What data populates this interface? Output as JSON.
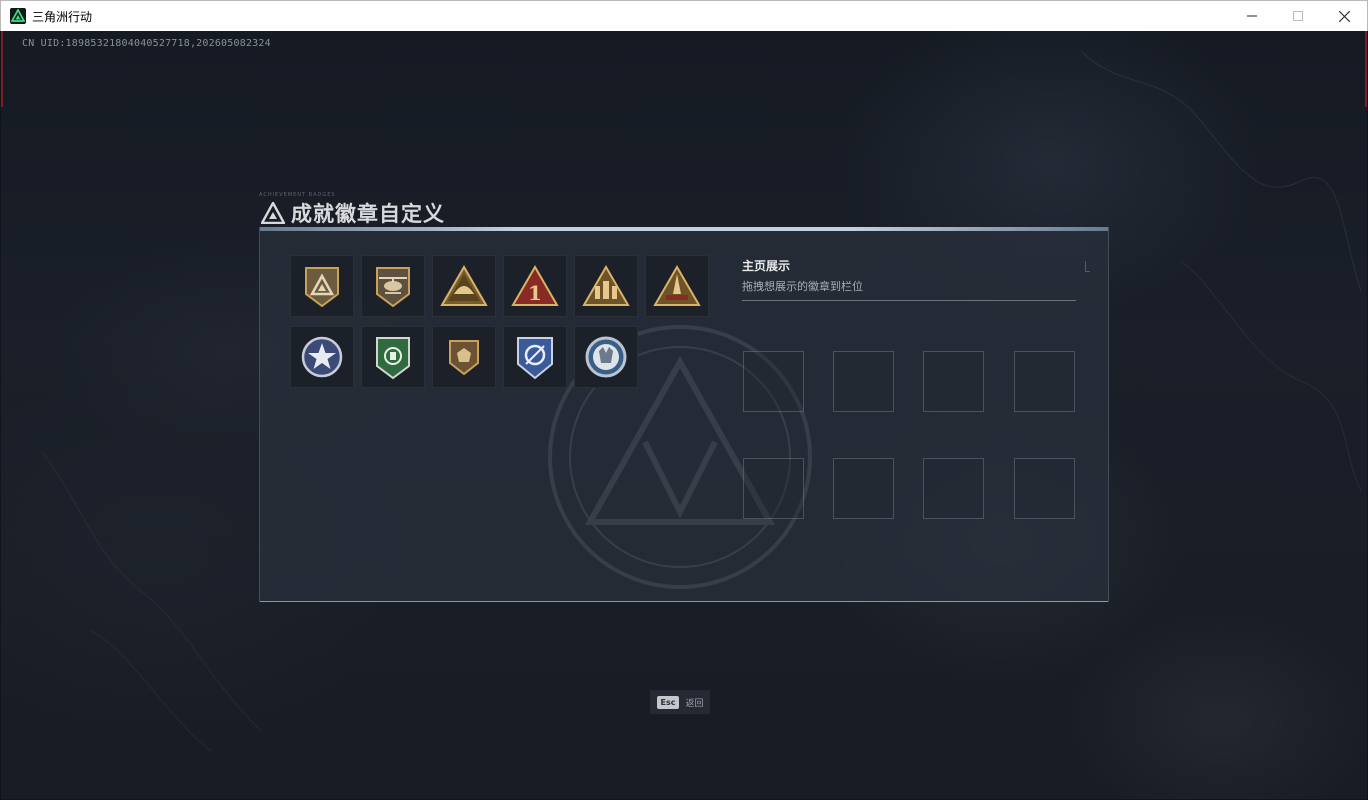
{
  "window": {
    "title": "三角洲行动",
    "controls": [
      "minimize",
      "maximize",
      "close"
    ]
  },
  "uid_text": "CN UID:1898532180404052771​8,202605082324",
  "page": {
    "title": "成就徽章自定义",
    "caption": "ACHIEVEMENT BADGES"
  },
  "badges": [
    {
      "name": "delta-triangle-badge",
      "shape": "shield-bronze"
    },
    {
      "name": "helicopter-badge",
      "shape": "shield-bronze"
    },
    {
      "name": "dome-triangle-badge",
      "shape": "triangle-gold"
    },
    {
      "name": "number-one-triangle-badge",
      "shape": "triangle-red"
    },
    {
      "name": "squad-triangle-badge",
      "shape": "triangle-gold"
    },
    {
      "name": "rocket-triangle-badge",
      "shape": "triangle-gold"
    },
    {
      "name": "star-circle-badge",
      "shape": "circle-silver"
    },
    {
      "name": "green-shield-badge",
      "shape": "shield-green"
    },
    {
      "name": "lion-shield-badge",
      "shape": "shield-bronze-small"
    },
    {
      "name": "blue-shield-badge",
      "shape": "shield-blue"
    },
    {
      "name": "wolf-circle-badge",
      "shape": "circle-blue"
    }
  ],
  "showcase": {
    "title": "主页展示",
    "subtitle": "拖拽想展示的徽章到栏位",
    "slot_count": 8
  },
  "footer": {
    "key": "Esc",
    "label": "返回"
  },
  "colors": {
    "accent_gold": "#c9a25a",
    "accent_red": "#8a2a24",
    "accent_green": "#2f6b3f",
    "panel_bg": "#2a303c"
  }
}
